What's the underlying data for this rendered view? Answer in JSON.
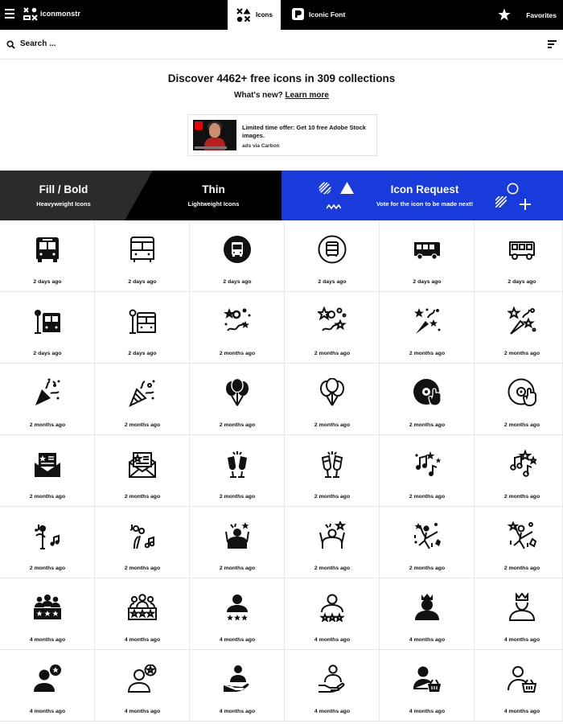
{
  "topbar": {
    "brand": "iconmonstr",
    "tabs": [
      {
        "label": "Icons",
        "active": true
      },
      {
        "label": "Iconic Font",
        "active": false
      }
    ],
    "favorites_label": "Favorites"
  },
  "search": {
    "placeholder": "Search ..."
  },
  "hero": {
    "headline": "Discover 4462+ free icons in 309 collections",
    "whats_new": "What's new?",
    "learn_more": "Learn more"
  },
  "ad": {
    "title": "Limited time offer: Get 10 free Adobe Stock images.",
    "via": "ads via Carbon"
  },
  "banners": {
    "fill": {
      "title": "Fill / Bold",
      "subtitle": "Heavyweight Icons"
    },
    "thin": {
      "title": "Thin",
      "subtitle": "Lightweight Icons"
    },
    "request": {
      "title": "Icon Request",
      "subtitle": "Vote for the icon to be made next!"
    }
  },
  "colors": {
    "request_blue": "#1a3bdc",
    "topbar": "#000000",
    "fill_banner": "#2b2b2b"
  },
  "icons": [
    {
      "icon": "bus-front-fill",
      "date": "2 days ago"
    },
    {
      "icon": "bus-front-thin",
      "date": "2 days ago"
    },
    {
      "icon": "bus-circle-fill",
      "date": "2 days ago"
    },
    {
      "icon": "bus-circle-thin",
      "date": "2 days ago"
    },
    {
      "icon": "bus-side-fill",
      "date": "2 days ago"
    },
    {
      "icon": "bus-side-thin",
      "date": "2 days ago"
    },
    {
      "icon": "bus-stop-fill",
      "date": "2 days ago"
    },
    {
      "icon": "bus-stop-thin",
      "date": "2 days ago"
    },
    {
      "icon": "confetti-fill",
      "date": "2 months ago"
    },
    {
      "icon": "confetti-thin",
      "date": "2 months ago"
    },
    {
      "icon": "fireworks-fill",
      "date": "2 months ago"
    },
    {
      "icon": "fireworks-thin",
      "date": "2 months ago"
    },
    {
      "icon": "party-popper-fill",
      "date": "2 months ago"
    },
    {
      "icon": "party-popper-thin",
      "date": "2 months ago"
    },
    {
      "icon": "balloons-fill",
      "date": "2 months ago"
    },
    {
      "icon": "balloons-thin",
      "date": "2 months ago"
    },
    {
      "icon": "vinyl-fill",
      "date": "2 months ago"
    },
    {
      "icon": "vinyl-thin",
      "date": "2 months ago"
    },
    {
      "icon": "invitation-fill",
      "date": "2 months ago"
    },
    {
      "icon": "invitation-thin",
      "date": "2 months ago"
    },
    {
      "icon": "cheers-fill",
      "date": "2 months ago"
    },
    {
      "icon": "cheers-thin",
      "date": "2 months ago"
    },
    {
      "icon": "music-notes-fill",
      "date": "2 months ago"
    },
    {
      "icon": "music-notes-thin",
      "date": "2 months ago"
    },
    {
      "icon": "karaoke-fill",
      "date": "2 months ago"
    },
    {
      "icon": "karaoke-thin",
      "date": "2 months ago"
    },
    {
      "icon": "cheering-fill",
      "date": "2 months ago"
    },
    {
      "icon": "cheering-thin",
      "date": "2 months ago"
    },
    {
      "icon": "dancer-fill",
      "date": "2 months ago"
    },
    {
      "icon": "dancer-thin",
      "date": "2 months ago"
    },
    {
      "icon": "audience-rating-fill",
      "date": "4 months ago"
    },
    {
      "icon": "audience-rating-thin",
      "date": "4 months ago"
    },
    {
      "icon": "user-rating-fill",
      "date": "4 months ago"
    },
    {
      "icon": "user-rating-thin",
      "date": "4 months ago"
    },
    {
      "icon": "king-fill",
      "date": "4 months ago"
    },
    {
      "icon": "king-thin",
      "date": "4 months ago"
    },
    {
      "icon": "user-favorite-fill",
      "date": "4 months ago"
    },
    {
      "icon": "user-favorite-thin",
      "date": "4 months ago"
    },
    {
      "icon": "user-hand-fill",
      "date": "4 months ago"
    },
    {
      "icon": "user-hand-thin",
      "date": "4 months ago"
    },
    {
      "icon": "user-basket-fill",
      "date": "4 months ago"
    },
    {
      "icon": "user-basket-thin",
      "date": "4 months ago"
    }
  ]
}
